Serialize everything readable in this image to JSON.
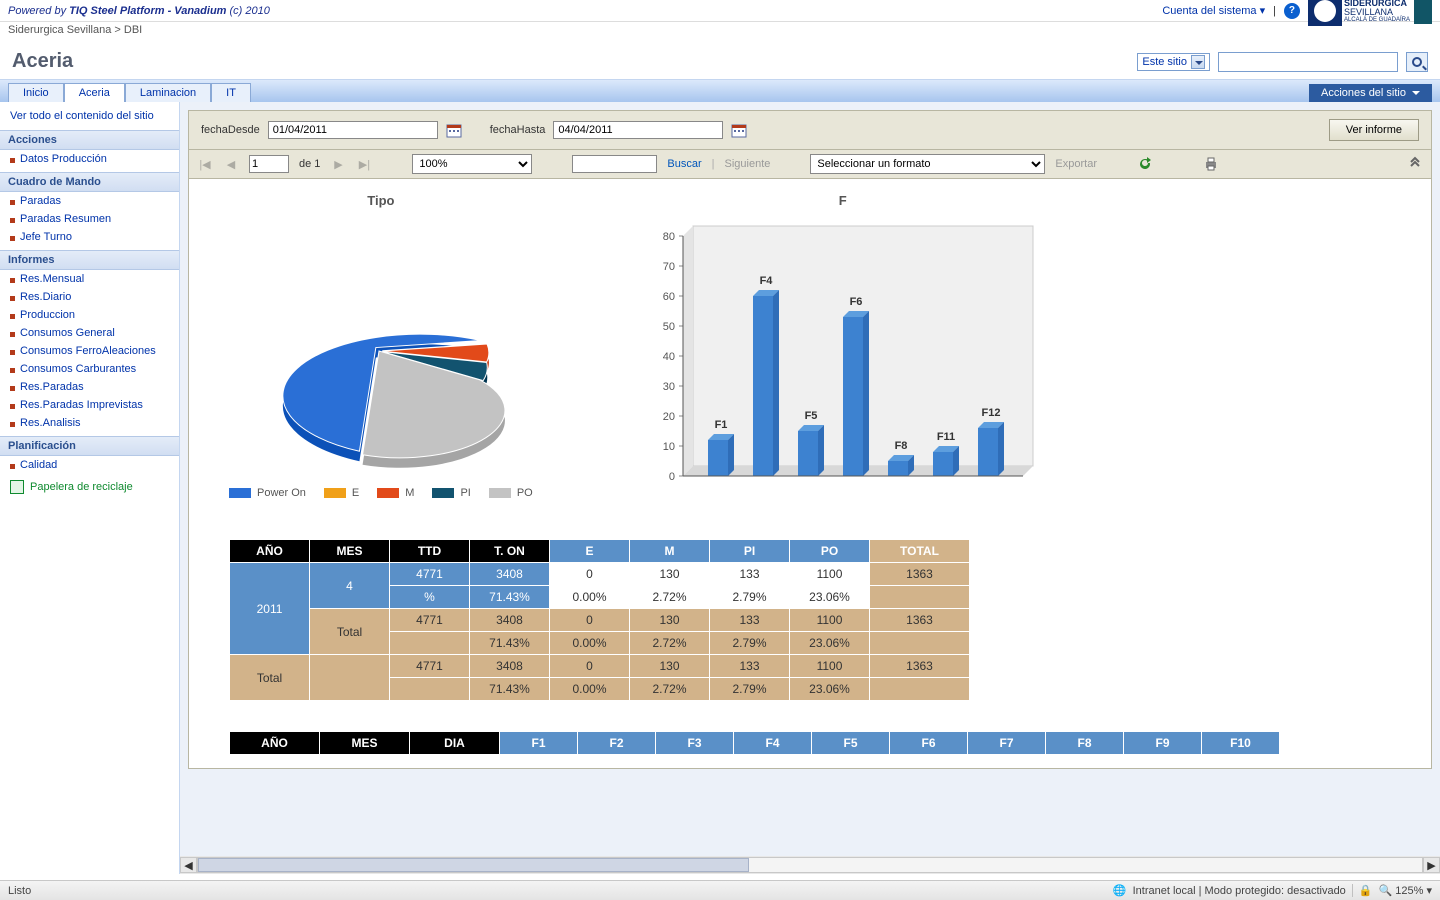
{
  "topbar": {
    "powered_by_prefix": "Powered by ",
    "platform_name": "TIQ Steel Platform - Vanadium",
    "copyright": " (c) 2010",
    "system_account": "Cuenta del sistema",
    "logo_title": "SIDERÚRGICA",
    "logo_sub": "SEVILLANA",
    "logo_sub2": "ALCALÁ DE GUADAÍRA"
  },
  "breadcrumb": "Siderurgica Sevillana > DBI",
  "page_title": "Aceria",
  "scope_label": "Este sitio",
  "search_placeholder": "",
  "tabs": [
    "Inicio",
    "Aceria",
    "Laminacion",
    "IT"
  ],
  "active_tab": 1,
  "site_actions_label": "Acciones del sitio",
  "sidebar": {
    "view_all": "Ver todo el contenido del sitio",
    "sections": [
      {
        "title": "Acciones",
        "items": [
          "Datos Producción"
        ]
      },
      {
        "title": "Cuadro de Mando",
        "items": [
          "Paradas",
          "Paradas Resumen",
          "Jefe Turno"
        ]
      },
      {
        "title": "Informes",
        "items": [
          "Res.Mensual",
          "Res.Diario",
          "Produccion",
          "Consumos General",
          "Consumos FerroAleaciones",
          "Consumos Carburantes",
          "Res.Paradas",
          "Res.Paradas Imprevistas",
          "Res.Analisis"
        ]
      },
      {
        "title": "Planificación",
        "items": [
          "Calidad"
        ]
      }
    ],
    "recycle": "Papelera de reciclaje"
  },
  "params": {
    "from_label": "fechaDesde",
    "from_value": "01/04/2011",
    "to_label": "fechaHasta",
    "to_value": "04/04/2011",
    "view_button": "Ver informe"
  },
  "toolbar": {
    "page_value": "1",
    "page_of": "de 1",
    "zoom_value": "100%",
    "search_label": "Buscar",
    "next_label": "Siguiente",
    "format_placeholder": "Seleccionar un formato",
    "export_label": "Exportar"
  },
  "chart_data": [
    {
      "type": "pie",
      "title": "Tipo",
      "series": [
        {
          "name": "Power On",
          "value": 3408,
          "color": "#2a6fd6"
        },
        {
          "name": "E",
          "value": 0,
          "color": "#f0a019"
        },
        {
          "name": "M",
          "value": 130,
          "color": "#e24a1a"
        },
        {
          "name": "PI",
          "value": 133,
          "color": "#12536f"
        },
        {
          "name": "PO",
          "value": 1100,
          "color": "#c3c3c3"
        }
      ]
    },
    {
      "type": "bar",
      "title": "F",
      "ylabel": "",
      "xlabel": "",
      "ylim": [
        0,
        80
      ],
      "categories": [
        "F1",
        "F4",
        "F5",
        "F6",
        "F8",
        "F11",
        "F12"
      ],
      "values": [
        12,
        60,
        15,
        53,
        5,
        8,
        16
      ]
    }
  ],
  "table": {
    "headers_dark": [
      "AÑO",
      "MES",
      "TTD",
      "T. ON"
    ],
    "headers_blue": [
      "E",
      "M",
      "PI",
      "PO"
    ],
    "header_total": "TOTAL",
    "rows": [
      {
        "ano": "2011",
        "mes": "4",
        "ttd": "4771",
        "ton": "3408",
        "e": "0",
        "m": "130",
        "pi": "133",
        "po": "1100",
        "total": "1363"
      },
      {
        "ano": "",
        "mes": "",
        "ttd": "%",
        "ton": "71.43%",
        "e": "0.00%",
        "m": "2.72%",
        "pi": "2.79%",
        "po": "23.06%",
        "total": ""
      },
      {
        "ano": "",
        "mes": "Total",
        "ttd": "4771",
        "ton": "3408",
        "e": "0",
        "m": "130",
        "pi": "133",
        "po": "1100",
        "total": "1363"
      },
      {
        "ano": "",
        "mes": "",
        "ttd": "",
        "ton": "71.43%",
        "e": "0.00%",
        "m": "2.72%",
        "pi": "2.79%",
        "po": "23.06%",
        "total": ""
      },
      {
        "ano": "Total",
        "mes": "",
        "ttd": "4771",
        "ton": "3408",
        "e": "0",
        "m": "130",
        "pi": "133",
        "po": "1100",
        "total": "1363"
      },
      {
        "ano": "",
        "mes": "",
        "ttd": "",
        "ton": "71.43%",
        "e": "0.00%",
        "m": "2.72%",
        "pi": "2.79%",
        "po": "23.06%",
        "total": ""
      }
    ]
  },
  "table2": {
    "headers_dark": [
      "AÑO",
      "MES",
      "DIA"
    ],
    "headers_blue": [
      "F1",
      "F2",
      "F3",
      "F4",
      "F5",
      "F6",
      "F7",
      "F8",
      "F9",
      "F10"
    ]
  },
  "statusbar": {
    "ready": "Listo",
    "zone": "Intranet local | Modo protegido: desactivado",
    "zoom": "125%"
  }
}
